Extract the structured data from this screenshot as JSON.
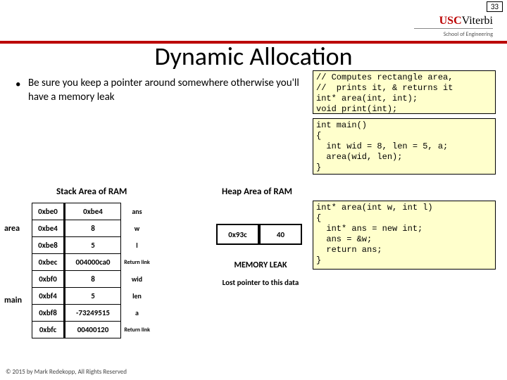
{
  "page_number": "33",
  "logo": {
    "usc": "USC",
    "viterbi": "Viterbi",
    "school": "School of Engineering"
  },
  "title": "Dynamic Allocation",
  "bullet": "Be sure you keep a pointer around somewhere otherwise you'll have a memory leak",
  "code1": "// Computes rectangle area,\n//  prints it, & returns it\nint* area(int, int);\nvoid print(int);",
  "code2": "int main()\n{\n  int wid = 8, len = 5, a;\n  area(wid, len);\n}",
  "code3": "int* area(int w, int l)\n{\n  int* ans = new int;\n  ans = &w;\n  return ans;\n}",
  "stack_title": "Stack Area of RAM",
  "heap_title": "Heap Area of RAM",
  "area_label": "area",
  "main_label": "main",
  "stack": [
    {
      "addr": "0xbe0",
      "val": "0xbe4",
      "lbl": "ans"
    },
    {
      "addr": "0xbe4",
      "val": "8",
      "lbl": "w"
    },
    {
      "addr": "0xbe8",
      "val": "5",
      "lbl": "l"
    },
    {
      "addr": "0xbec",
      "val": "004000ca0",
      "lbl": "Return link"
    },
    {
      "addr": "0xbf0",
      "val": "8",
      "lbl": "wid"
    },
    {
      "addr": "0xbf4",
      "val": "5",
      "lbl": "len"
    },
    {
      "addr": "0xbf8",
      "val": "-73249515",
      "lbl": "a"
    },
    {
      "addr": "0xbfc",
      "val": "00400120",
      "lbl": "Return link"
    }
  ],
  "heap": {
    "addr": "0x93c",
    "val": "40"
  },
  "mem_leak": "MEMORY LEAK",
  "lost": "Lost pointer to this data",
  "footer": "© 2015 by Mark Redekopp, All Rights Reserved"
}
